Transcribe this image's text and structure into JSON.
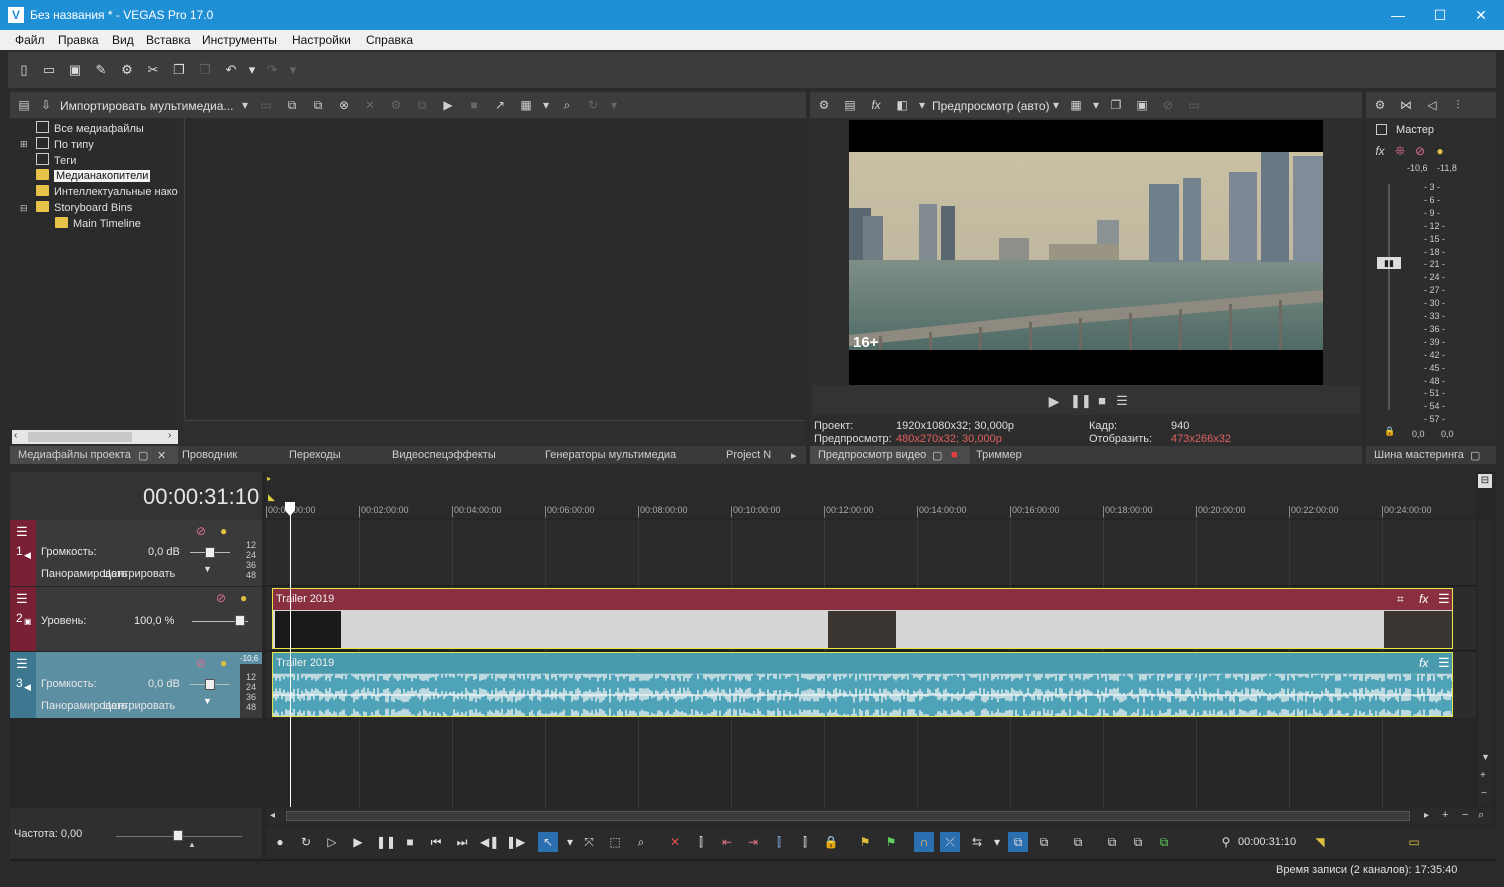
{
  "window": {
    "title": "Без названия * - VEGAS Pro 17.0",
    "logo": "V",
    "minimize": "—",
    "maximize": "☐",
    "close": "✕"
  },
  "menu": [
    "Файл",
    "Правка",
    "Вид",
    "Вставка",
    "Инструменты",
    "Настройки",
    "Справка"
  ],
  "media_panel": {
    "import_label": "Импортировать мультимедиа...",
    "tree": [
      "Все медиафайлы",
      "По типу",
      "Теги",
      "Медианакопители",
      "Интеллектуальные нако",
      "Storyboard Bins",
      "Main Timeline"
    ],
    "tabs": [
      "Медиафайлы проекта",
      "Проводник",
      "Переходы",
      "Видеоспецэффекты",
      "Генераторы мультимедиа",
      "Project N"
    ]
  },
  "preview": {
    "quality_label": "Предпросмотр (авто)",
    "rating_badge": "16+",
    "project_label": "Проект:",
    "project_value": "1920x1080x32; 30,000p",
    "preview_label": "Предпросмотр:",
    "preview_value": "480x270x32; 30,000p",
    "frame_label": "Кадр:",
    "frame_value": "940",
    "display_label": "Отобразить:",
    "display_value": "473x266x32",
    "tabs": [
      "Предпросмотр видео",
      "Триммер"
    ]
  },
  "master": {
    "label": "Мастер",
    "peak_left": "-10,6",
    "peak_right": "-11,8",
    "scale": [
      "3",
      "6",
      "9",
      "12",
      "15",
      "18",
      "21",
      "24",
      "27",
      "30",
      "33",
      "36",
      "39",
      "42",
      "45",
      "48",
      "51",
      "54",
      "57"
    ],
    "bottom_left": "0,0",
    "bottom_right": "0,0",
    "tab": "Шина мастеринга"
  },
  "timeline": {
    "timecode": "00:00:31:10",
    "ruler": [
      "00:00:00:00",
      "00:02:00:00",
      "00:04:00:00",
      "00:06:00:00",
      "00:08:00:00",
      "00:10:00:00",
      "00:12:00:00",
      "00:14:00:00",
      "00:16:00:00",
      "00:18:00:00",
      "00:20:00:00",
      "00:22:00:00",
      "00:24:00:00"
    ],
    "tracks": [
      {
        "num": "1",
        "vol_label": "Громкость:",
        "vol_value": "0,0 dB",
        "pan_label": "Панорамировать",
        "pan_value": "Центрировать",
        "scale": [
          "12",
          "24",
          "36",
          "48"
        ]
      },
      {
        "num": "2",
        "level_label": "Уровень:",
        "level_value": "100,0 %"
      },
      {
        "num": "3",
        "vol_label": "Громкость:",
        "vol_value": "0,0 dB",
        "pan_label": "Панорамировать",
        "pan_value": "Центрировать",
        "peak": "-10,6",
        "scale": [
          "12",
          "24",
          "36",
          "48"
        ]
      }
    ],
    "clips": [
      "Trailer 2019",
      "Trailer 2019"
    ],
    "rate_label": "Частота: 0,00",
    "cursor_time": "00:00:31:10"
  },
  "status": "Время записи (2 каналов): 17:35:40",
  "colors": {
    "titlebar": "#1f8fd6",
    "video_track": "#8a2f40",
    "audio_track": "#4a9aae",
    "waveform": "#5fb8c9",
    "highlight": "#e6e64a"
  }
}
